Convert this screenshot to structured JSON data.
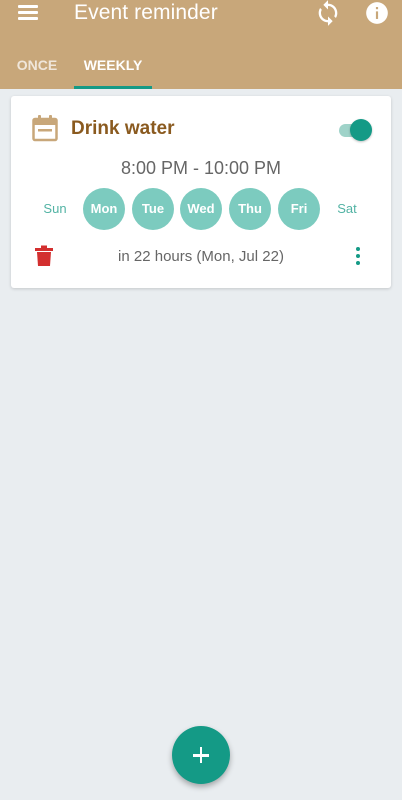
{
  "app": {
    "title": "Event reminder"
  },
  "tabs": [
    {
      "label": "ONCE",
      "selected": false
    },
    {
      "label": "WEEKLY",
      "selected": true
    }
  ],
  "colors": {
    "app_bar": "#c8a77a",
    "accent": "#149a86",
    "active_day": "#7ccbbf",
    "title": "#8a5a1f",
    "delete": "#d32f2f"
  },
  "reminder": {
    "title": "Drink water",
    "enabled": true,
    "time_range": "8:00 PM - 10:00 PM",
    "days": [
      {
        "label": "Sun",
        "active": false
      },
      {
        "label": "Mon",
        "active": true
      },
      {
        "label": "Tue",
        "active": true
      },
      {
        "label": "Wed",
        "active": true
      },
      {
        "label": "Thu",
        "active": true
      },
      {
        "label": "Fri",
        "active": true
      },
      {
        "label": "Sat",
        "active": false
      }
    ],
    "next_occurrence": "in 22 hours (Mon, Jul 22)"
  },
  "icons": {
    "menu": "menu-icon",
    "sync": "sync-icon",
    "info": "info-icon",
    "calendar": "calendar-icon",
    "delete": "trash-icon",
    "more": "more-vert-icon",
    "add": "plus-icon"
  }
}
